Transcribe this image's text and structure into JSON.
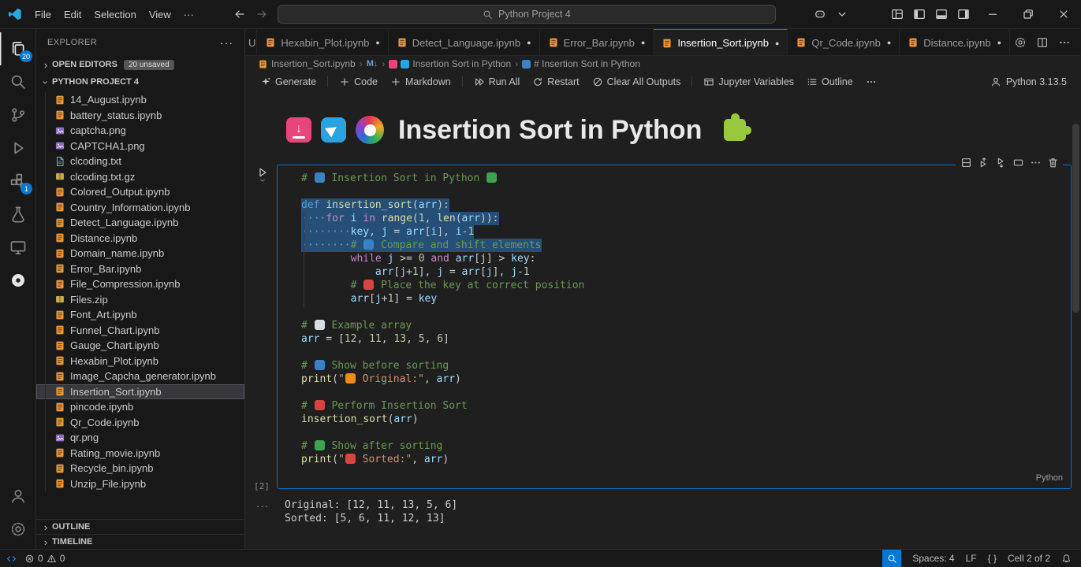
{
  "colors": {
    "accent": "#0078d4",
    "selection": "#264f78",
    "comment": "#6a9955",
    "keyword": "#569cd6",
    "flow": "#c586c0",
    "func": "#dcdcaa",
    "num": "#b5cea8",
    "str": "#ce9178",
    "varb": "#9cdcfe",
    "icon_inbox": "#e8457c",
    "icon_telegram": "#2ba3e0",
    "icon_puzzle": "#97c93d"
  },
  "titlebar": {
    "menus": [
      "File",
      "Edit",
      "Selection",
      "View"
    ],
    "more": "···",
    "search_value": "Python Project 4",
    "right_icons": [
      "copilot",
      "chevron-down",
      "layout-grid",
      "panel-left",
      "panel-bottom",
      "panel-right",
      "minimize",
      "maximize",
      "close"
    ]
  },
  "activity_bar": {
    "items": [
      {
        "icon": "files",
        "badge": "20",
        "active": true
      },
      {
        "icon": "search"
      },
      {
        "icon": "source-control"
      },
      {
        "icon": "run-debug"
      },
      {
        "icon": "extensions",
        "badge": "1"
      },
      {
        "icon": "testing"
      },
      {
        "icon": "desktop"
      },
      {
        "icon": "circle-extension"
      }
    ],
    "bottom": [
      {
        "icon": "account"
      },
      {
        "icon": "settings-gear"
      }
    ]
  },
  "sidebar": {
    "title": "EXPLORER",
    "title_more": "···",
    "open_editors_label": "OPEN EDITORS",
    "open_editors_badge": "20 unsaved",
    "project_label": "PYTHON PROJECT 4",
    "files": [
      {
        "name": "14_August.ipynb",
        "type": "ipynb"
      },
      {
        "name": "battery_status.ipynb",
        "type": "ipynb"
      },
      {
        "name": "captcha.png",
        "type": "png"
      },
      {
        "name": "CAPTCHA1.png",
        "type": "png"
      },
      {
        "name": "clcoding.txt",
        "type": "txt"
      },
      {
        "name": "clcoding.txt.gz",
        "type": "gz"
      },
      {
        "name": "Colored_Output.ipynb",
        "type": "ipynb"
      },
      {
        "name": "Country_Information.ipynb",
        "type": "ipynb"
      },
      {
        "name": "Detect_Language.ipynb",
        "type": "ipynb"
      },
      {
        "name": "Distance.ipynb",
        "type": "ipynb"
      },
      {
        "name": "Domain_name.ipynb",
        "type": "ipynb"
      },
      {
        "name": "Error_Bar.ipynb",
        "type": "ipynb"
      },
      {
        "name": "File_Compression.ipynb",
        "type": "ipynb"
      },
      {
        "name": "Files.zip",
        "type": "zip"
      },
      {
        "name": "Font_Art.ipynb",
        "type": "ipynb"
      },
      {
        "name": "Funnel_Chart.ipynb",
        "type": "ipynb"
      },
      {
        "name": "Gauge_Chart.ipynb",
        "type": "ipynb"
      },
      {
        "name": "Hexabin_Plot.ipynb",
        "type": "ipynb"
      },
      {
        "name": "Image_Capcha_generator.ipynb",
        "type": "ipynb"
      },
      {
        "name": "Insertion_Sort.ipynb",
        "type": "ipynb",
        "selected": true
      },
      {
        "name": "pincode.ipynb",
        "type": "ipynb"
      },
      {
        "name": "Qr_Code.ipynb",
        "type": "ipynb"
      },
      {
        "name": "qr.png",
        "type": "png"
      },
      {
        "name": "Rating_movie.ipynb",
        "type": "ipynb"
      },
      {
        "name": "Recycle_bin.ipynb",
        "type": "ipynb"
      },
      {
        "name": "Unzip_File.ipynb",
        "type": "ipynb"
      }
    ],
    "outline_label": "OUTLINE",
    "timeline_label": "TIMELINE"
  },
  "tabs": {
    "items": [
      {
        "label": "Unzip_File.ipynb",
        "dirty": true,
        "clipped": true
      },
      {
        "label": "Hexabin_Plot.ipynb",
        "dirty": true
      },
      {
        "label": "Detect_Language.ipynb",
        "dirty": true
      },
      {
        "label": "Error_Bar.ipynb",
        "dirty": true
      },
      {
        "label": "Insertion_Sort.ipynb",
        "dirty": true,
        "active": true
      },
      {
        "label": "Qr_Code.ipynb",
        "dirty": true
      },
      {
        "label": "Distance.ipynb",
        "dirty": true
      }
    ],
    "actions": [
      "settings-gear",
      "split-editor",
      "more"
    ]
  },
  "breadcrumb": {
    "items": [
      {
        "label": "Insertion_Sort.ipynb",
        "icon": "notebook"
      },
      {
        "label": "M↓",
        "md": true
      },
      {
        "label": "Insertion Sort in Python",
        "chips": [
          "#e8457c",
          "#2ba3e0"
        ]
      },
      {
        "label": "# Insertion Sort in Python",
        "chips": [
          "#3b82c4"
        ]
      }
    ]
  },
  "notebook_toolbar": {
    "buttons": [
      {
        "label": "Generate",
        "icon": "sparkle",
        "sep_after": true
      },
      {
        "label": "Code",
        "icon": "plus"
      },
      {
        "label": "Markdown",
        "icon": "plus",
        "sep_after": true
      },
      {
        "label": "Run All",
        "icon": "run-all"
      },
      {
        "label": "Restart",
        "icon": "restart"
      },
      {
        "label": "Clear All Outputs",
        "icon": "clear-outputs",
        "sep_after": true
      },
      {
        "label": "Jupyter Variables",
        "icon": "variables"
      },
      {
        "label": "Outline",
        "icon": "outline-list"
      },
      {
        "label": "",
        "icon": "more"
      }
    ],
    "kernel_label": "Python 3.13.5"
  },
  "markdown_cell": {
    "heading": "Insertion Sort in Python"
  },
  "code_cell": {
    "execution_count": "[2]",
    "language": "Python",
    "output_more": "···",
    "toolbar_icons": [
      "split-cell",
      "execute-above",
      "execute-below",
      "frame",
      "more",
      "delete"
    ],
    "lines": [
      {
        "tk": [
          {
            "c": "cm",
            "t": "# "
          },
          {
            "c": "em",
            "t": "📘",
            "bg": "#3b82c4"
          },
          {
            "c": "cm",
            "t": " Insertion Sort in Python "
          },
          {
            "c": "em",
            "t": "🔄",
            "bg": "#3fa34d"
          }
        ]
      },
      {
        "tk": []
      },
      {
        "sel": true,
        "tk": [
          {
            "c": "kw",
            "t": "def"
          },
          {
            "c": "pl",
            "t": " "
          },
          {
            "c": "fn",
            "t": "insertion_sort"
          },
          {
            "c": "pl",
            "t": "("
          },
          {
            "c": "vr",
            "t": "arr"
          },
          {
            "c": "pl",
            "t": "):"
          }
        ]
      },
      {
        "sel": true,
        "tk": [
          {
            "c": "ws",
            "t": "····"
          },
          {
            "c": "fl",
            "t": "for"
          },
          {
            "c": "pl",
            "t": " "
          },
          {
            "c": "vr",
            "t": "i"
          },
          {
            "c": "pl",
            "t": " "
          },
          {
            "c": "fl",
            "t": "in"
          },
          {
            "c": "pl",
            "t": " "
          },
          {
            "c": "fn",
            "t": "range"
          },
          {
            "c": "pl",
            "t": "("
          },
          {
            "c": "nu",
            "t": "1"
          },
          {
            "c": "pl",
            "t": ", "
          },
          {
            "c": "fn",
            "t": "len"
          },
          {
            "c": "pl",
            "t": "("
          },
          {
            "c": "vr",
            "t": "arr"
          },
          {
            "c": "pl",
            "t": ")):"
          }
        ]
      },
      {
        "sel": true,
        "tk": [
          {
            "c": "ws",
            "t": "········"
          },
          {
            "c": "vr",
            "t": "key"
          },
          {
            "c": "pl",
            "t": ", "
          },
          {
            "c": "vr",
            "t": "j"
          },
          {
            "c": "pl",
            "t": " = "
          },
          {
            "c": "vr",
            "t": "arr"
          },
          {
            "c": "pl",
            "t": "["
          },
          {
            "c": "vr",
            "t": "i"
          },
          {
            "c": "pl",
            "t": "], "
          },
          {
            "c": "vr",
            "t": "i"
          },
          {
            "c": "pl",
            "t": "-"
          },
          {
            "c": "nu",
            "t": "1"
          }
        ]
      },
      {
        "sel": true,
        "tk": [
          {
            "c": "ws",
            "t": "········"
          },
          {
            "c": "cm",
            "t": "# "
          },
          {
            "c": "em",
            "t": "🔍",
            "bg": "#3b82c4"
          },
          {
            "c": "cm",
            "t": " Compare and shift elements"
          }
        ]
      },
      {
        "tk": [
          {
            "c": "pl",
            "t": "        "
          },
          {
            "c": "fl",
            "t": "while"
          },
          {
            "c": "pl",
            "t": " "
          },
          {
            "c": "vr",
            "t": "j"
          },
          {
            "c": "pl",
            "t": " >= "
          },
          {
            "c": "nu",
            "t": "0"
          },
          {
            "c": "pl",
            "t": " "
          },
          {
            "c": "fl",
            "t": "and"
          },
          {
            "c": "pl",
            "t": " "
          },
          {
            "c": "vr",
            "t": "arr"
          },
          {
            "c": "pl",
            "t": "["
          },
          {
            "c": "vr",
            "t": "j"
          },
          {
            "c": "pl",
            "t": "] > "
          },
          {
            "c": "vr",
            "t": "key"
          },
          {
            "c": "pl",
            "t": ":"
          }
        ]
      },
      {
        "tk": [
          {
            "c": "pl",
            "t": "            "
          },
          {
            "c": "vr",
            "t": "arr"
          },
          {
            "c": "pl",
            "t": "["
          },
          {
            "c": "vr",
            "t": "j"
          },
          {
            "c": "pl",
            "t": "+"
          },
          {
            "c": "nu",
            "t": "1"
          },
          {
            "c": "pl",
            "t": "], "
          },
          {
            "c": "vr",
            "t": "j"
          },
          {
            "c": "pl",
            "t": " = "
          },
          {
            "c": "vr",
            "t": "arr"
          },
          {
            "c": "pl",
            "t": "["
          },
          {
            "c": "vr",
            "t": "j"
          },
          {
            "c": "pl",
            "t": "], "
          },
          {
            "c": "vr",
            "t": "j"
          },
          {
            "c": "pl",
            "t": "-"
          },
          {
            "c": "nu",
            "t": "1"
          }
        ]
      },
      {
        "tk": [
          {
            "c": "pl",
            "t": "        "
          },
          {
            "c": "cm",
            "t": "# "
          },
          {
            "c": "em",
            "t": "📌",
            "bg": "#d64541"
          },
          {
            "c": "cm",
            "t": " Place the key at correct position"
          }
        ]
      },
      {
        "tk": [
          {
            "c": "pl",
            "t": "        "
          },
          {
            "c": "vr",
            "t": "arr"
          },
          {
            "c": "pl",
            "t": "["
          },
          {
            "c": "vr",
            "t": "j"
          },
          {
            "c": "pl",
            "t": "+"
          },
          {
            "c": "nu",
            "t": "1"
          },
          {
            "c": "pl",
            "t": "] = "
          },
          {
            "c": "vr",
            "t": "key"
          }
        ]
      },
      {
        "tk": []
      },
      {
        "tk": [
          {
            "c": "cm",
            "t": "# "
          },
          {
            "c": "em",
            "t": "📄",
            "bg": "#d8dde3"
          },
          {
            "c": "cm",
            "t": " Example array"
          }
        ]
      },
      {
        "tk": [
          {
            "c": "vr",
            "t": "arr"
          },
          {
            "c": "pl",
            "t": " = ["
          },
          {
            "c": "nu",
            "t": "12"
          },
          {
            "c": "pl",
            "t": ", "
          },
          {
            "c": "nu",
            "t": "11"
          },
          {
            "c": "pl",
            "t": ", "
          },
          {
            "c": "nu",
            "t": "13"
          },
          {
            "c": "pl",
            "t": ", "
          },
          {
            "c": "nu",
            "t": "5"
          },
          {
            "c": "pl",
            "t": ", "
          },
          {
            "c": "nu",
            "t": "6"
          },
          {
            "c": "pl",
            "t": "]"
          }
        ]
      },
      {
        "tk": []
      },
      {
        "tk": [
          {
            "c": "cm",
            "t": "# "
          },
          {
            "c": "em",
            "t": "📊",
            "bg": "#3b82c4"
          },
          {
            "c": "cm",
            "t": " Show before sorting"
          }
        ]
      },
      {
        "tk": [
          {
            "c": "fn",
            "t": "print"
          },
          {
            "c": "pl",
            "t": "("
          },
          {
            "c": "st",
            "t": "\""
          },
          {
            "c": "em",
            "t": "🍊",
            "bg": "#f08c1a"
          },
          {
            "c": "st",
            "t": " Original:\""
          },
          {
            "c": "pl",
            "t": ", "
          },
          {
            "c": "vr",
            "t": "arr"
          },
          {
            "c": "pl",
            "t": ")"
          }
        ]
      },
      {
        "tk": []
      },
      {
        "tk": [
          {
            "c": "cm",
            "t": "# "
          },
          {
            "c": "em",
            "t": "🚀",
            "bg": "#d64541"
          },
          {
            "c": "cm",
            "t": " Perform Insertion Sort"
          }
        ]
      },
      {
        "tk": [
          {
            "c": "fn",
            "t": "insertion_sort"
          },
          {
            "c": "pl",
            "t": "("
          },
          {
            "c": "vr",
            "t": "arr"
          },
          {
            "c": "pl",
            "t": ")"
          }
        ]
      },
      {
        "tk": []
      },
      {
        "tk": [
          {
            "c": "cm",
            "t": "# "
          },
          {
            "c": "em",
            "t": "✅",
            "bg": "#3fa34d"
          },
          {
            "c": "cm",
            "t": " Show after sorting"
          }
        ]
      },
      {
        "tk": [
          {
            "c": "fn",
            "t": "print"
          },
          {
            "c": "pl",
            "t": "("
          },
          {
            "c": "st",
            "t": "\""
          },
          {
            "c": "em",
            "t": "🎯",
            "bg": "#d64541"
          },
          {
            "c": "st",
            "t": " Sorted:\""
          },
          {
            "c": "pl",
            "t": ", "
          },
          {
            "c": "vr",
            "t": "arr"
          },
          {
            "c": "pl",
            "t": ")"
          }
        ]
      }
    ],
    "outputs": [
      "Original: [12, 11, 13, 5, 6]",
      "Sorted: [5, 6, 11, 12, 13]"
    ]
  },
  "status_bar": {
    "errors": "0",
    "warnings": "0",
    "spaces": "Spaces: 4",
    "eol": "LF",
    "braces": "{ }",
    "cell": "Cell 2 of 2"
  }
}
